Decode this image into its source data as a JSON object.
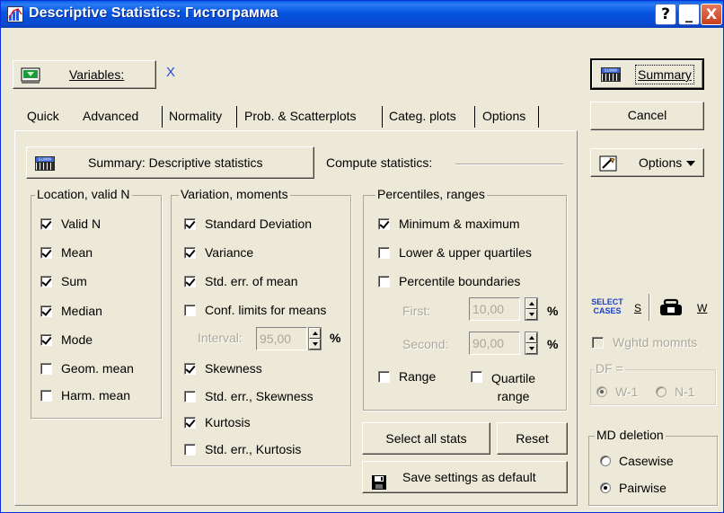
{
  "window": {
    "title": "Descriptive Statistics: Гистограмма",
    "help": "?",
    "minimize": "_",
    "close": "X"
  },
  "variables": {
    "label": "Variables:",
    "value": "X"
  },
  "right": {
    "summary": "Summary",
    "cancel": "Cancel",
    "options": "Options",
    "select_cases_top": "SELECT",
    "select_cases_bottom": "CASES",
    "s_label": "S",
    "w_label": "W",
    "wghtd": "Wghtd momnts",
    "df_title": "DF =",
    "df_opt1": "W-1",
    "df_opt2": "N-1",
    "md_title": "MD deletion",
    "md_opt1": "Casewise",
    "md_opt2": "Pairwise",
    "md_selected": "Pairwise"
  },
  "tabs": [
    {
      "label": "Quick"
    },
    {
      "label": "Advanced"
    },
    {
      "label": "Normality"
    },
    {
      "label": "Prob. & Scatterplots"
    },
    {
      "label": "Categ. plots"
    },
    {
      "label": "Options"
    }
  ],
  "active_tab": "Advanced",
  "summary_desc": "Summary: Descriptive statistics",
  "compute_label": "Compute statistics:",
  "location": {
    "title": "Location, valid N",
    "items": [
      {
        "label": "Valid N",
        "checked": true
      },
      {
        "label": "Mean",
        "checked": true
      },
      {
        "label": "Sum",
        "checked": true
      },
      {
        "label": "Median",
        "checked": true
      },
      {
        "label": "Mode",
        "checked": true
      },
      {
        "label": "Geom. mean",
        "checked": false
      },
      {
        "label": "Harm. mean",
        "checked": false
      }
    ]
  },
  "variation": {
    "title": "Variation, moments",
    "items": [
      {
        "label": "Standard Deviation",
        "checked": true
      },
      {
        "label": "Variance",
        "checked": true
      },
      {
        "label": "Std. err. of mean",
        "checked": true
      },
      {
        "label": "Conf. limits for means",
        "checked": false
      },
      {
        "label": "Skewness",
        "checked": true
      },
      {
        "label": "Std. err., Skewness",
        "checked": false
      },
      {
        "label": "Kurtosis",
        "checked": true
      },
      {
        "label": "Std. err., Kurtosis",
        "checked": false
      }
    ],
    "interval_label": "Interval:",
    "interval_value": "95,00",
    "pct": "%"
  },
  "percentiles": {
    "title": "Percentiles, ranges",
    "items": [
      {
        "label": "Minimum & maximum",
        "checked": true
      },
      {
        "label": "Lower & upper quartiles",
        "checked": false
      },
      {
        "label": "Percentile boundaries",
        "checked": false
      }
    ],
    "first_label": "First:",
    "first_value": "10,00",
    "second_label": "Second:",
    "second_value": "90,00",
    "pct": "%",
    "range_label": "Range",
    "range_checked": false,
    "quartile_label_1": "Quartile",
    "quartile_label_2": "range",
    "quartile_checked": false
  },
  "buttons": {
    "select_all": "Select all stats",
    "reset": "Reset",
    "save_default": "Save settings as default"
  }
}
